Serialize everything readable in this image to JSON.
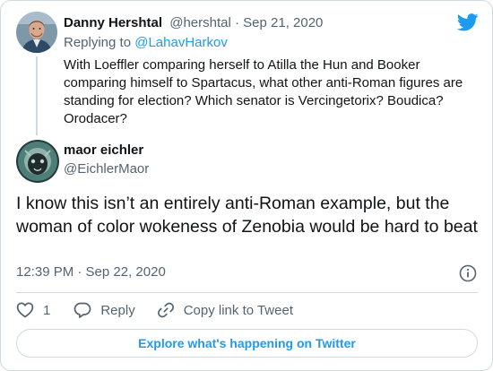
{
  "parent_tweet": {
    "author_name": "Danny Hershtal",
    "handle": "@hershtal",
    "separator": " · ",
    "date": "Sep 21, 2020",
    "replying_prefix": "Replying to ",
    "replying_to": "@LahavHarkov",
    "text": "With Loeffler comparing herself to Atilla the Hun and Booker comparing himself to Spartacus, what other anti-Roman figures are standing for election? Which senator is Vercingetorix? Boudica? Orodacer?"
  },
  "reply_tweet": {
    "author_name": "maor eichler",
    "handle": "@EichlerMaor",
    "text": "I know this isn’t an entirely anti-Roman example, but the woman of color wokeness of Zenobia would be hard to beat",
    "timestamp": "12:39 PM · Sep 22, 2020"
  },
  "actions": {
    "like_count": "1",
    "reply_label": "Reply",
    "copy_link_label": "Copy link to Tweet"
  },
  "explore_label": "Explore what's happening on Twitter",
  "icons": {
    "brand": "twitter-bird-icon",
    "info": "info-icon",
    "like": "heart-icon",
    "reply": "speech-bubble-icon",
    "copy_link": "link-icon"
  },
  "colors": {
    "accent": "#1d9bf0",
    "text": "#0f1419",
    "muted": "#536471",
    "border": "#cfd9de"
  }
}
